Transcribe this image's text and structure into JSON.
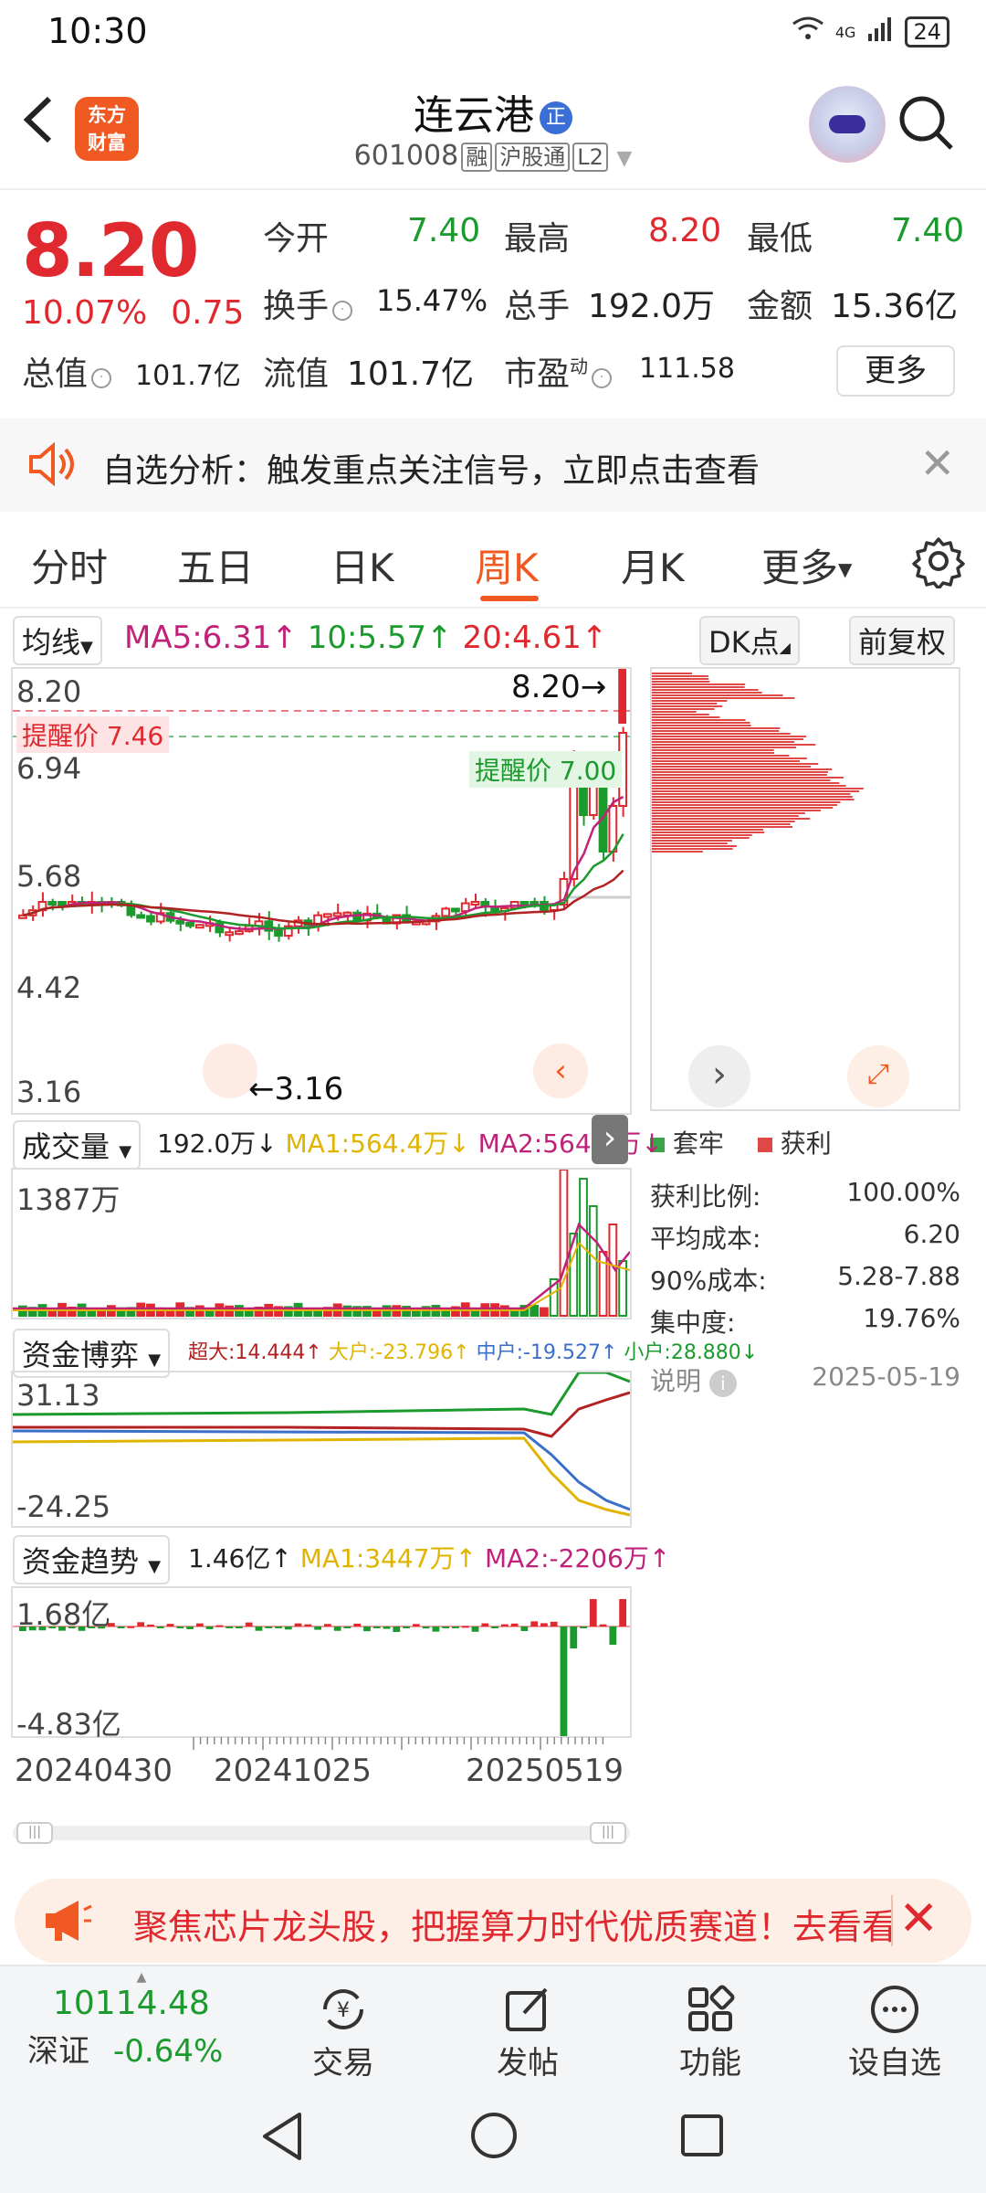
{
  "status_bar": {
    "time": "10:30",
    "network": "4G",
    "battery": "24"
  },
  "header": {
    "app_logo": "东方\n财富",
    "stock_name": "连云港",
    "name_badge": "正",
    "code": "601008",
    "tags": [
      "融",
      "沪股通",
      "L2"
    ]
  },
  "quote": {
    "price": "8.20",
    "change_pct": "10.07%",
    "change": "0.75",
    "rows": [
      [
        {
          "label": "今开",
          "value": "7.40",
          "color": "green"
        },
        {
          "label": "最高",
          "value": "8.20",
          "color": "red"
        },
        {
          "label": "最低",
          "value": "7.40",
          "color": "green"
        }
      ],
      [
        {
          "label": "换手",
          "value": "15.47%"
        },
        {
          "label": "总手",
          "value": "192.0万"
        },
        {
          "label": "金额",
          "value": "15.36亿"
        }
      ],
      [
        {
          "label": "总值",
          "value": "101.7亿"
        },
        {
          "label": "流值",
          "value": "101.7亿"
        },
        {
          "label": "市盈",
          "sup": "动",
          "value": "111.58"
        }
      ]
    ],
    "more": "更多"
  },
  "notice": {
    "text": "自选分析：触发重点关注信号，立即点击查看"
  },
  "tabs": [
    "分时",
    "五日",
    "日K",
    "周K",
    "月K",
    "更多"
  ],
  "active_tab": "周K",
  "kline": {
    "ma_label": "均线",
    "ma5": "MA5:6.31",
    "ma10": "10:5.57",
    "ma20": "20:4.61",
    "dk_label": "DK点",
    "fq_label": "前复权",
    "y_ticks": [
      "8.20",
      "6.94",
      "5.68",
      "4.42",
      "3.16"
    ],
    "high_label": "8.20",
    "low_label": "3.16",
    "alert1": "提醒价 7.46",
    "alert2": "提醒价 7.00",
    "chip_legend": [
      "套牢",
      "获利"
    ]
  },
  "volume": {
    "label": "成交量",
    "value": "192.0万",
    "ma1": "MA1:564.4万",
    "ma2": "MA2:564.4万",
    "max": "1387万"
  },
  "fund_game": {
    "label": "资金博弈",
    "super": "超大:14.444",
    "big": "大户:-23.796",
    "mid": "中户:-19.527",
    "small": "小户:28.880",
    "max": "31.13",
    "min": "-24.25"
  },
  "fund_trend": {
    "label": "资金趋势",
    "value": "1.46亿",
    "ma1": "MA1:3447万",
    "ma2": "MA2:-2206万",
    "max": "1.68亿",
    "min": "-4.83亿"
  },
  "x_dates": [
    "20240430",
    "20241025",
    "20250519"
  ],
  "chip_stats": {
    "rows": [
      {
        "label": "获利比例:",
        "value": "100.00%"
      },
      {
        "label": "平均成本:",
        "value": "6.20"
      },
      {
        "label": "90%成本:",
        "value": "5.28-7.88"
      },
      {
        "label": "集中度:",
        "value": "19.76%"
      }
    ],
    "note_label": "说明",
    "note_date": "2025-05-19"
  },
  "banner": {
    "text": "聚焦芯片龙头股，把握算力时代优质赛道！去看看"
  },
  "bottom_nav": {
    "index_value": "10114.48",
    "index_name": "深证",
    "index_change": "-0.64%",
    "items": [
      "交易",
      "发帖",
      "功能",
      "设自选"
    ]
  },
  "colors": {
    "red": "#e0282f",
    "green": "#1b9a2e",
    "accent": "#f05a22"
  }
}
